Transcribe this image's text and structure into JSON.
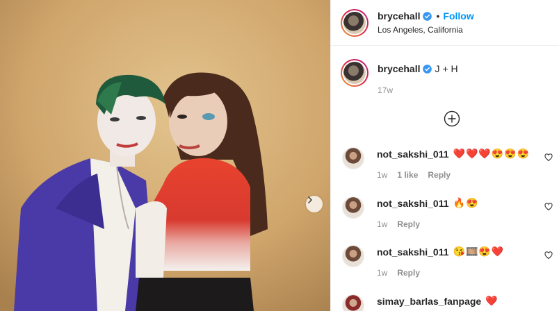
{
  "header": {
    "username": "brycehall",
    "separator": "•",
    "follow_label": "Follow",
    "location": "Los Angeles, California"
  },
  "caption": {
    "username": "brycehall",
    "text": "J + H",
    "time": "17w"
  },
  "comments": [
    {
      "username": "not_sakshi_011",
      "text": "❤️❤️❤️😍😍😍",
      "time": "1w",
      "likes": "1 like",
      "reply": "Reply"
    },
    {
      "username": "not_sakshi_011",
      "text": "🔥😍",
      "time": "1w",
      "reply": "Reply"
    },
    {
      "username": "not_sakshi_011",
      "text": "😘🎞️😍❤️",
      "time": "1w",
      "reply": "Reply"
    },
    {
      "username": "simay_barlas_fanpage",
      "text": "❤️"
    }
  ],
  "colors": {
    "accent": "#0095f6",
    "verified": "#3897f0",
    "muted": "#8e8e8e",
    "text": "#262626"
  },
  "icons": [
    "verified-badge-icon",
    "plus-circle-icon",
    "heart-outline-icon",
    "chevron-right-icon"
  ]
}
